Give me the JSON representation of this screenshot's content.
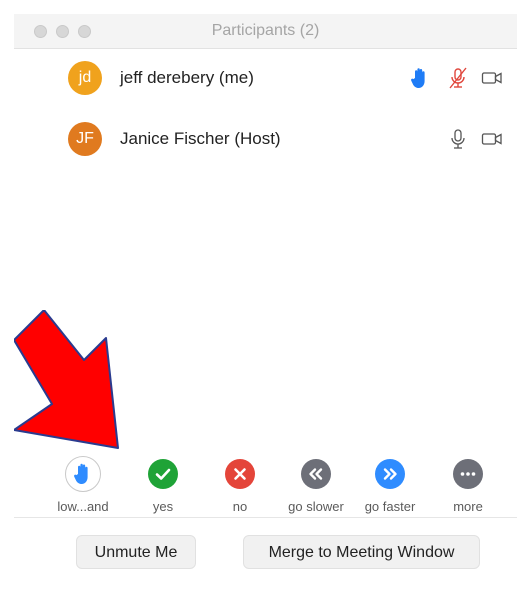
{
  "window": {
    "title": "Participants (2)"
  },
  "participants": [
    {
      "initials": "jd",
      "name": "jeff derebery (me)",
      "avatar_color": "#f0a21d",
      "hand_raised": true,
      "muted": true,
      "video": "off"
    },
    {
      "initials": "JF",
      "name": "Janice Fischer (Host)",
      "avatar_color": "#e07a1f",
      "hand_raised": false,
      "muted": false,
      "video": "off"
    }
  ],
  "reactions": [
    {
      "label": "low...and",
      "icon": "raised-hand-icon",
      "color": "#2f8cff"
    },
    {
      "label": "yes",
      "icon": "checkmark-icon",
      "color": "#1fa337"
    },
    {
      "label": "no",
      "icon": "x-icon",
      "color": "#e4453a"
    },
    {
      "label": "go slower",
      "icon": "rewind-icon",
      "color": "#6d6f78"
    },
    {
      "label": "go faster",
      "icon": "fast-forward-icon",
      "color": "#2f8cff"
    },
    {
      "label": "more",
      "icon": "more-dots-icon",
      "color": "#6d6f78"
    }
  ],
  "buttons": {
    "unmute": "Unmute Me",
    "merge": "Merge to Meeting Window"
  },
  "colors": {
    "hand_blue": "#1f7cf6",
    "muted_red": "#e0463c",
    "annotation_arrow": "#ff0000"
  }
}
